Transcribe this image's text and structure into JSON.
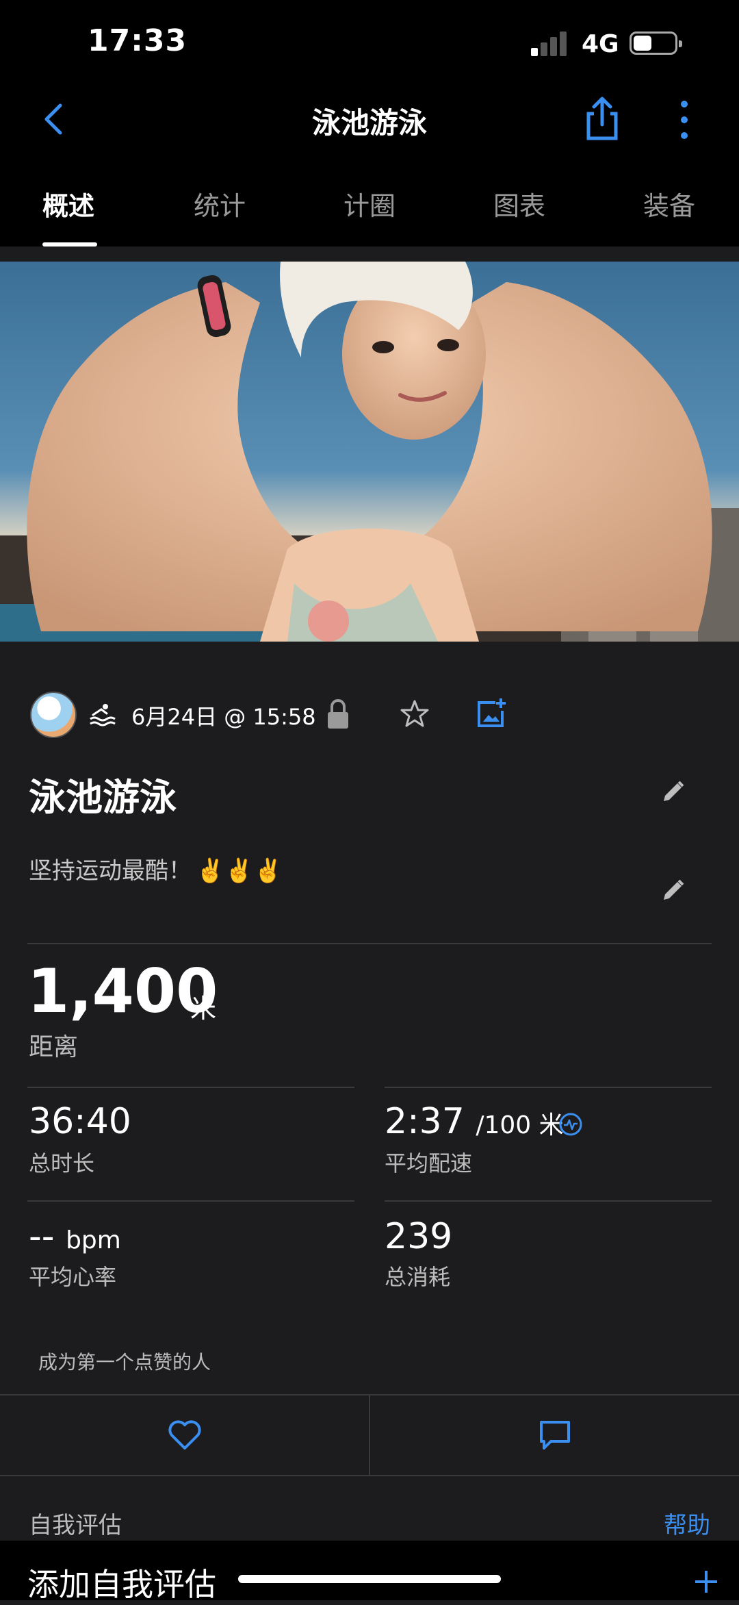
{
  "status_bar": {
    "time": "17:33",
    "network": "4G",
    "battery_level": 0.45
  },
  "nav": {
    "title": "泳池游泳"
  },
  "tabs": [
    {
      "label": "概述",
      "active": true
    },
    {
      "label": "统计"
    },
    {
      "label": "计圈"
    },
    {
      "label": "图表"
    },
    {
      "label": "装备"
    }
  ],
  "activity": {
    "date_time": "6月24日 @ 15:58",
    "title": "泳池游泳",
    "note": "坚持运动最酷！",
    "note_emoji": "✌️✌️✌️"
  },
  "stats": {
    "distance": {
      "value": "1,400",
      "unit": "米",
      "label": "距离"
    },
    "duration": {
      "value": "36:40",
      "label": "总时长"
    },
    "pace": {
      "value": "2:37",
      "unit": "/100 米",
      "label": "平均配速"
    },
    "heart_rate": {
      "value": "--",
      "unit": "bpm",
      "label": "平均心率"
    },
    "calories": {
      "value": "239",
      "label": "总消耗"
    }
  },
  "social": {
    "likes_text": "成为第一个点赞的人"
  },
  "self_assessment": {
    "header": "自我评估",
    "help_label": "帮助",
    "add_label": "添加自我评估"
  },
  "colors": {
    "accent": "#3b8ff0",
    "background": "#1c1c1e",
    "bar": "#000000"
  },
  "icons": [
    "back-icon",
    "share-icon",
    "more-icon",
    "swim-icon",
    "lock-icon",
    "star-icon",
    "add-photo-icon",
    "edit-icon",
    "pace-icon",
    "heart-icon",
    "comment-icon",
    "plus-icon"
  ]
}
